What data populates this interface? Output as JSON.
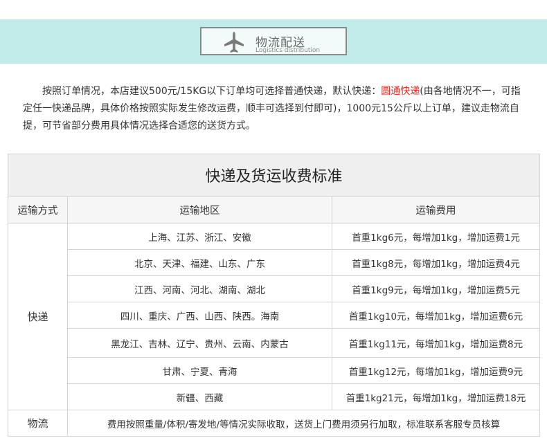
{
  "banner": {
    "title": "物流配送",
    "subtitle": "Logistics distribution",
    "icon": "airplane-icon",
    "bg_color": "#c1ebe8"
  },
  "intro": {
    "prefix": "按照订单情况，本店建议500元/15KG以下订单均可选择普通快递，默认快递：",
    "highlight": "圆通快递",
    "suffix": "(由各地情况不一，可指定任一快递品牌，具体价格按照实际发生修改运费，顺丰可选择到付即可)，1000元15公斤以上订单，建议走物流自提，可节省部分费用具体情况选择合适您的送货方式。",
    "highlight_color": "#e0261b"
  },
  "table": {
    "title": "快递及货运收费标准",
    "headers": [
      "运输方式",
      "运输地区",
      "运输费用"
    ],
    "express_label": "快递",
    "rows": [
      {
        "region": "上海、江苏、浙江、安徽",
        "fee": "首重1kg6元，每增加1kg，增加运费1元"
      },
      {
        "region": "北京、天津、福建、山东、广东",
        "fee": "首重1kg8元，每增加1kg，增加运费4元"
      },
      {
        "region": "江西、河南、河北、湖南、湖北",
        "fee": "首重1kg9元，每增加1kg，增加运费5元"
      },
      {
        "region": "四川、重庆、广西、山西、陕西。海南",
        "fee": "首重1kg10元，每增加1kg，增加运费6元"
      },
      {
        "region": "黑龙江、吉林、辽宁、贵州、云南、内蒙古",
        "fee": "首重1kg11元，每增加1kg，增加运费8元"
      },
      {
        "region": "甘肃、宁夏、青海",
        "fee": "首重1kg12元，每增加1kg，增加运费9元"
      },
      {
        "region": "新疆、西藏",
        "fee": "首重1kg21元，每增加1kg，增加运费18元"
      }
    ],
    "logistics_label": "物流",
    "logistics_note": "费用按照重量/体积/寄发地/等情况实际收取，送货上门费用须另行加取，标准联系客服专员核算"
  }
}
